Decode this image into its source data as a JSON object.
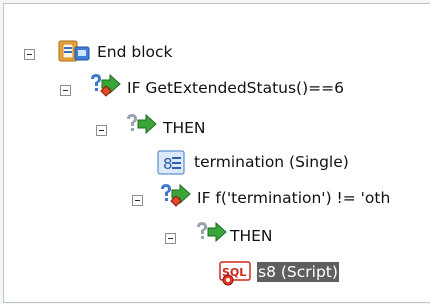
{
  "tree": {
    "root": {
      "label": "End block",
      "icon": "end-block-icon"
    },
    "if1": {
      "label": "IF GetExtendedStatus()==6",
      "icon": "condition-icon"
    },
    "then1": {
      "label": "THEN",
      "icon": "then-branch-icon"
    },
    "termination": {
      "label": "termination (Single)",
      "icon": "variable-icon"
    },
    "if2": {
      "label": "IF f('termination') != 'oth",
      "icon": "condition-icon"
    },
    "then2": {
      "label": "THEN",
      "icon": "then-branch-icon"
    },
    "script": {
      "label": "s8 (Script)",
      "icon": "script-icon",
      "selected": true
    }
  },
  "colors": {
    "selection": "#5f5f5f",
    "toggle_border": "#8c8c8c"
  }
}
